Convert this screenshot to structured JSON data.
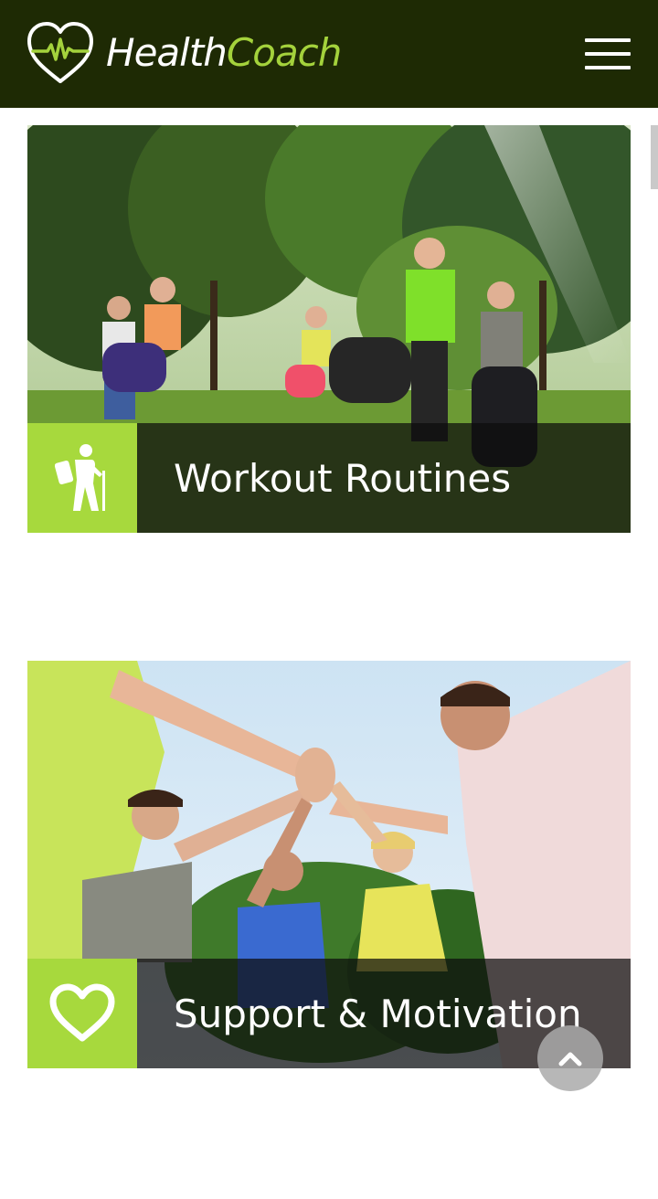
{
  "header": {
    "brand_part1": "Health",
    "brand_part2": "Coach",
    "logo_icon": "heart-pulse-icon",
    "menu_icon": "hamburger-menu-icon"
  },
  "cards": [
    {
      "title": "Workout Routines",
      "icon": "hiker-icon"
    },
    {
      "title": "Support & Motivation",
      "icon": "heart-outline-icon"
    }
  ],
  "back_to_top": {
    "icon": "chevron-up-icon"
  },
  "colors": {
    "header_bg": "#1e2a04",
    "accent_green": "#a7d93d",
    "logo_green": "#a4d23c",
    "overlay_dark": "rgba(12,12,12,0.72)"
  }
}
